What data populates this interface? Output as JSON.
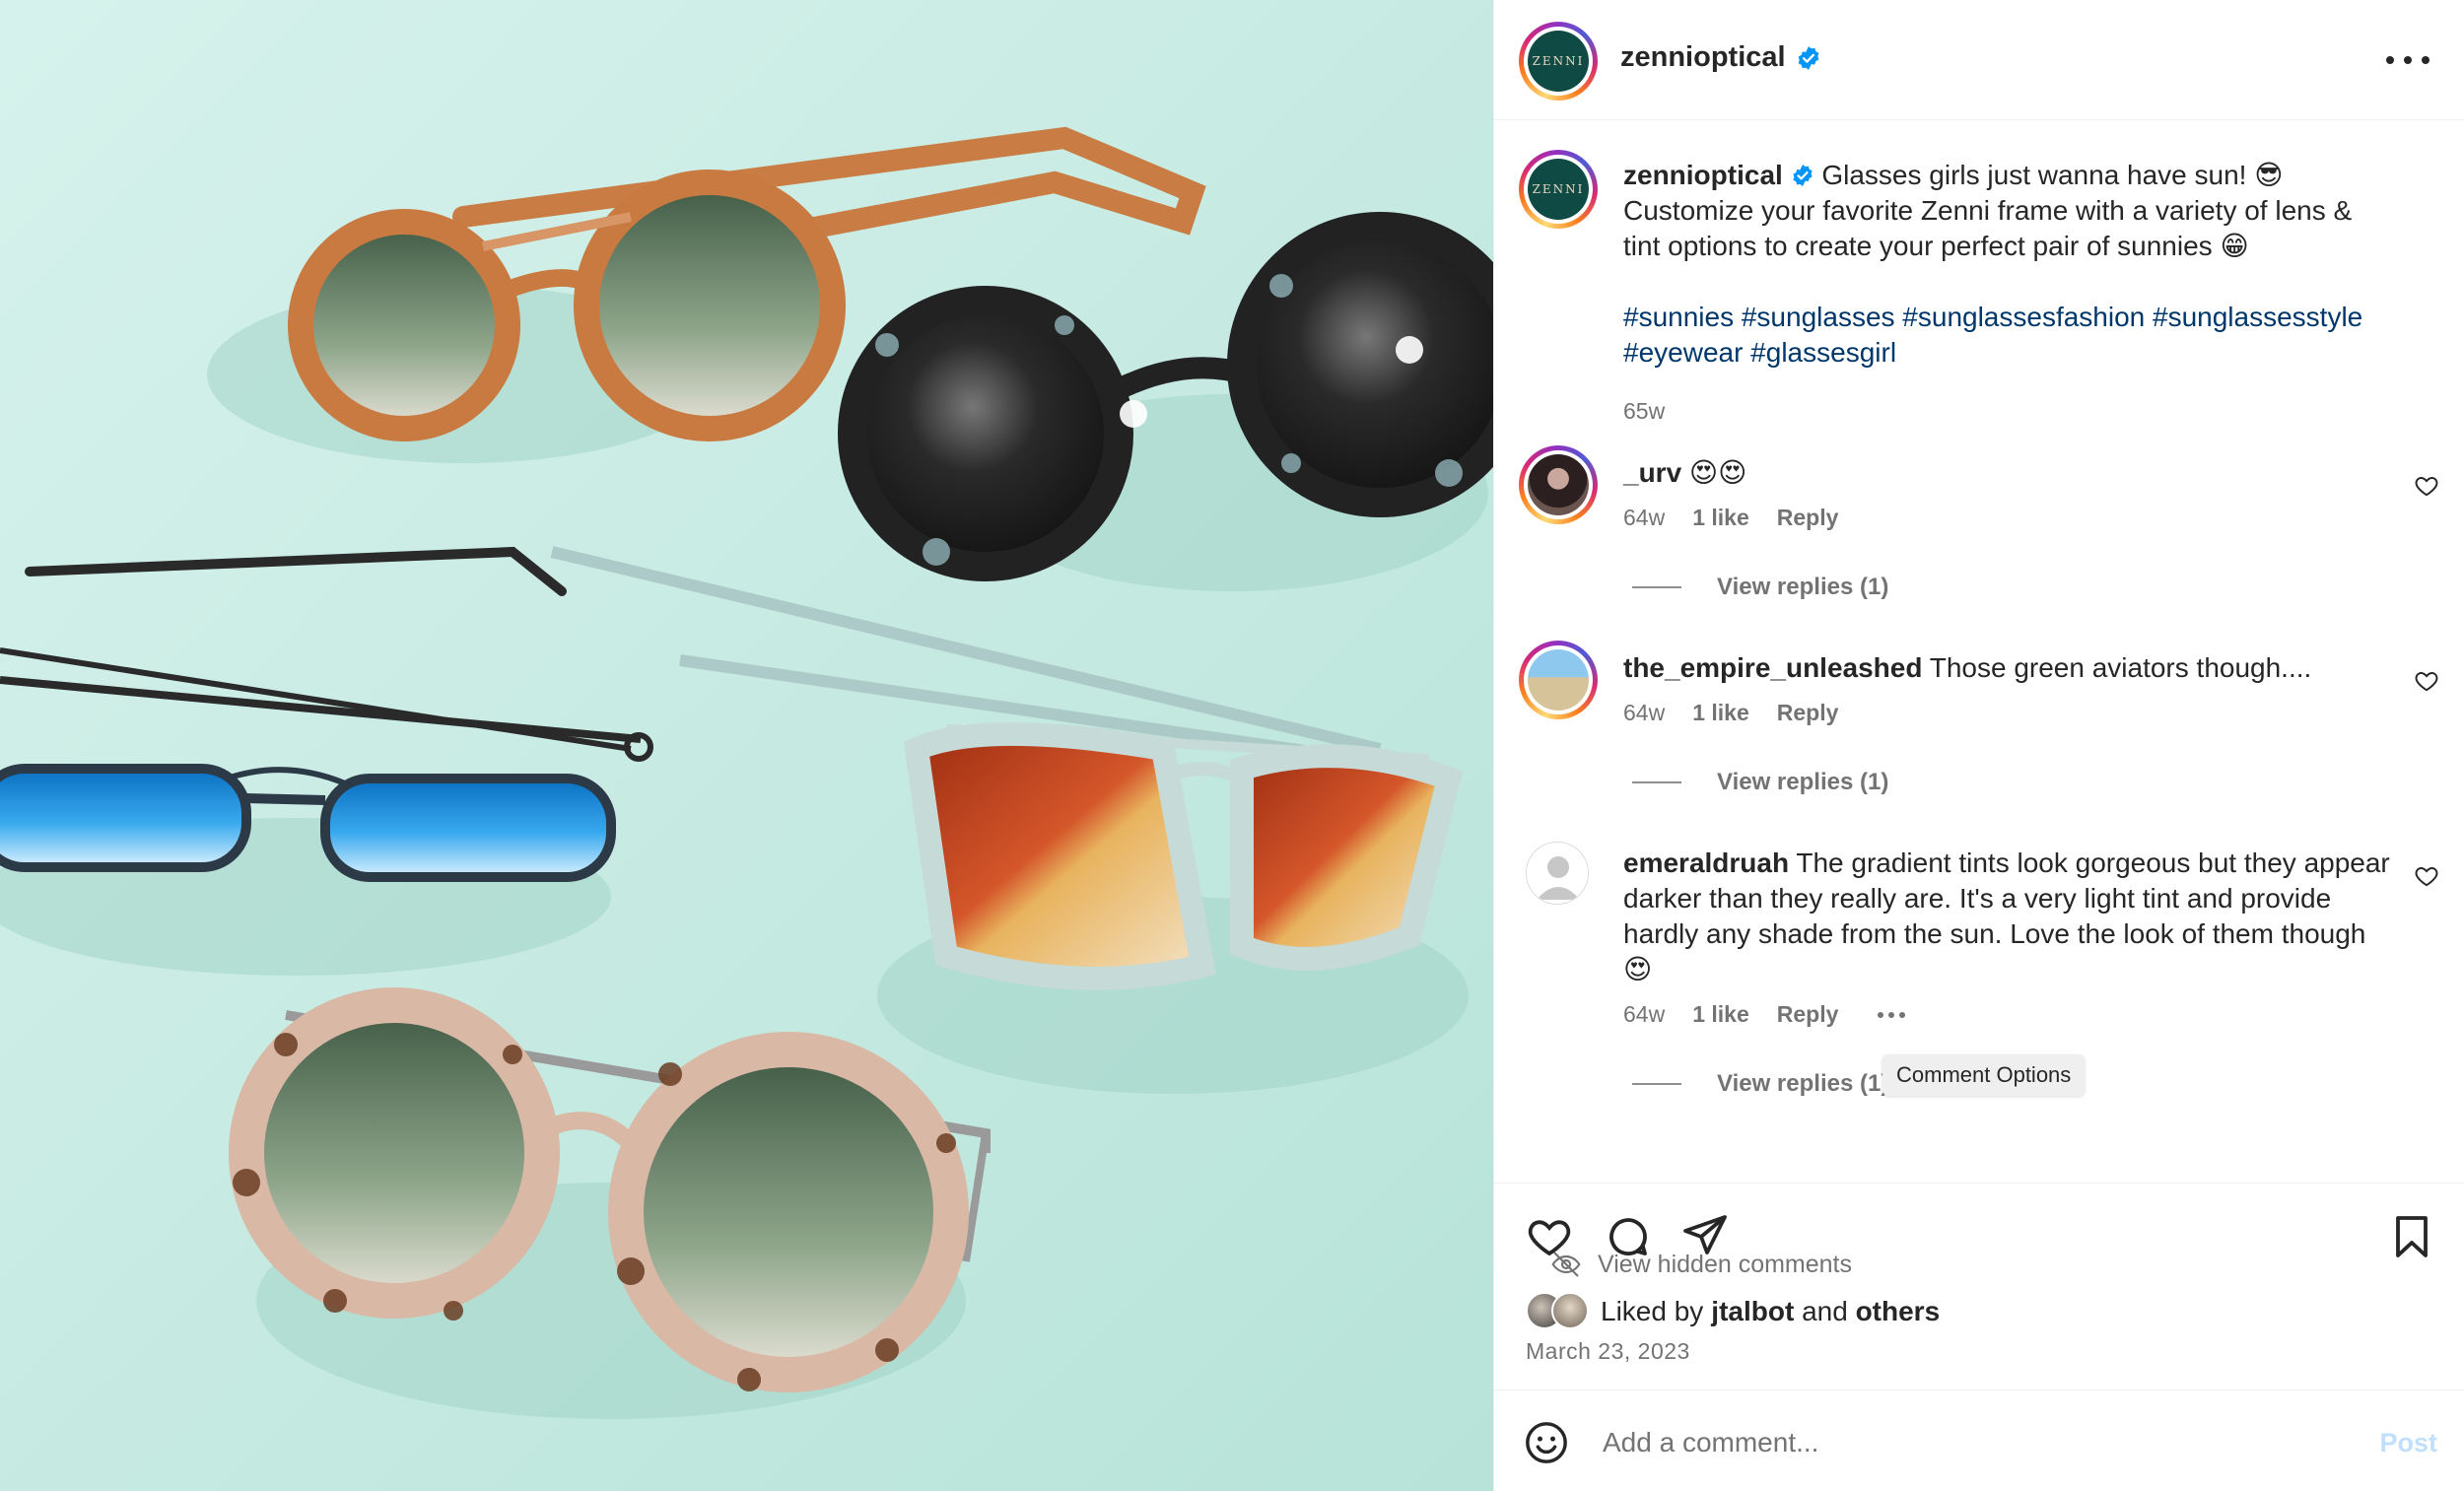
{
  "post": {
    "username": "zennioptical",
    "avatar_text": "ZENNI",
    "caption_line1": " Glasses girls just wanna have sun! 😎",
    "caption_line2": "Customize your favorite Zenni frame with a variety of lens &",
    "caption_line3": "tint options to create your perfect pair of sunnies 😁",
    "hashtags_line1": "#sunnies #sunglasses #sunglassesfashion #sunglassesstyle",
    "hashtags_line2": "#eyewear #glassesgirl",
    "time": "65w"
  },
  "comments": [
    {
      "username": "_urv",
      "text": " 😍😍",
      "time": "64w",
      "likes": "1 like",
      "reply": "Reply",
      "replies": "View replies (1)"
    },
    {
      "username": "the_empire_unleashed",
      "text": " Those green aviators though....",
      "time": "64w",
      "likes": "1 like",
      "reply": "Reply",
      "replies": "View replies (1)"
    },
    {
      "username": "emeraldruah",
      "text": " The gradient tints look gorgeous but they appear darker than they really are. It's a very light tint and provide hardly any shade from the sun. Love the look of them though 😍",
      "time": "64w",
      "likes": "1 like",
      "reply": "Reply",
      "replies": "View replies (1)"
    }
  ],
  "tooltip": "Comment Options",
  "hidden_comments": "View hidden comments",
  "liked_by": {
    "prefix": "Liked by ",
    "user": "jtalbot",
    "middle": " and ",
    "others": "others"
  },
  "date": "March 23, 2023",
  "add_comment": {
    "placeholder": "Add a comment...",
    "post_label": "Post"
  },
  "colors": {
    "accent_link": "#00376b",
    "post_button_disabled": "#c0dffd",
    "verified": "#0095f6",
    "photo_bg": "#c9ece4"
  },
  "icons": [
    "more-options-icon",
    "verified-badge-icon",
    "heart-icon",
    "comment-icon",
    "share-icon",
    "bookmark-icon",
    "emoji-icon",
    "eye-off-icon"
  ]
}
